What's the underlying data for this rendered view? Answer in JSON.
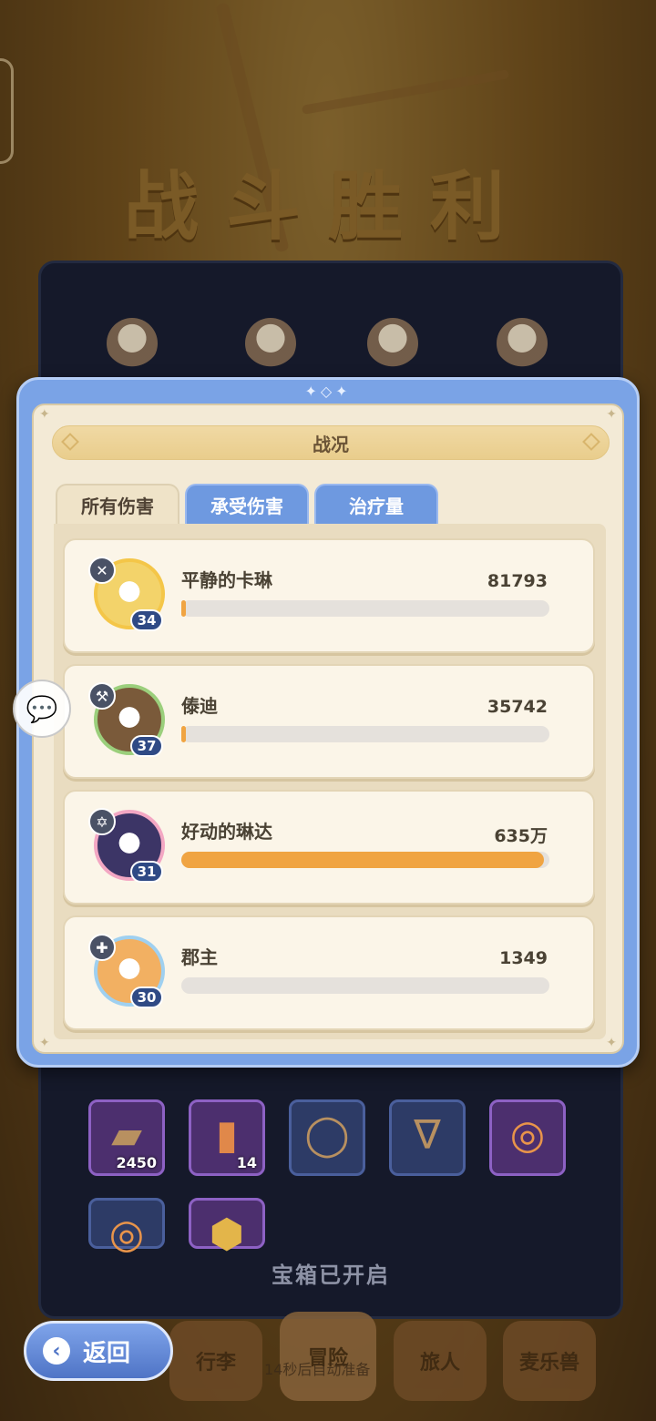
{
  "background": {
    "title": "战斗胜利"
  },
  "rewards": {
    "items": [
      {
        "count": "2450",
        "icon": "iron-bar-icon"
      },
      {
        "count": "14",
        "icon": "ticket-icon"
      },
      {
        "count": "",
        "icon": "necklace-icon"
      },
      {
        "count": "",
        "icon": "pendant-icon"
      },
      {
        "count": "",
        "icon": "ring-icon"
      },
      {
        "count": "",
        "icon": "ring-icon"
      },
      {
        "count": "",
        "icon": "medal-icon"
      }
    ],
    "status": "宝箱已开启"
  },
  "nav": {
    "back_label": "返回",
    "items": [
      "行李",
      "冒险",
      "旅人",
      "麦乐兽"
    ],
    "auto_hint": "14秒后自动准备"
  },
  "modal": {
    "title": "战况",
    "ornament": "✦◇✦",
    "tabs": [
      "所有伤害",
      "承受伤害",
      "治疗量"
    ],
    "active_tab": "所有伤害",
    "rows": [
      {
        "name": "平静的卡琳",
        "value": "81793",
        "level": "34",
        "bar_fraction": 0.01,
        "role_icon": "✕",
        "ring_color": "#f4c648",
        "bg_color": "#f3d36a"
      },
      {
        "name": "傣迪",
        "value": "35742",
        "level": "37",
        "bar_fraction": 0.005,
        "role_icon": "⚒",
        "ring_color": "#9bcf7c",
        "bg_color": "#7a5a3a"
      },
      {
        "name": "好动的琳达",
        "value": "635万",
        "level": "31",
        "bar_fraction": 0.985,
        "role_icon": "✡",
        "ring_color": "#f3a7c3",
        "bg_color": "#3c3566"
      },
      {
        "name": "郡主",
        "value": "1349",
        "level": "30",
        "bar_fraction": 0.0,
        "role_icon": "✚",
        "ring_color": "#9fd0f0",
        "bg_color": "#f2b062"
      }
    ]
  },
  "colors": {
    "accent_blue": "#7aa3e6",
    "bar_orange": "#f0a442",
    "panel_cream": "#f3ead6"
  }
}
